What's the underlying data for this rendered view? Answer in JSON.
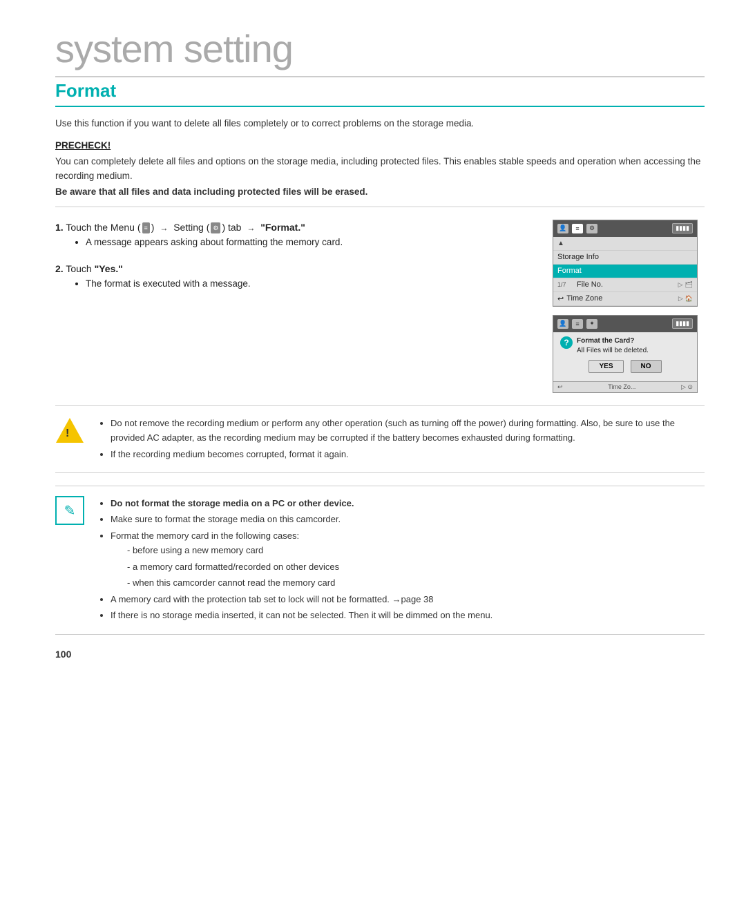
{
  "page": {
    "title": "system setting",
    "section": "Format",
    "page_number": "100"
  },
  "intro": {
    "text": "Use this function if you want to delete all files completely or to correct problems on the storage media."
  },
  "precheck": {
    "label": "PRECHECK!",
    "text1": "You can completely delete all files and options on the storage media, including protected files. This enables stable speeds and operation when accessing the recording medium.",
    "text2": "Be aware that all files and data including protected files will be erased."
  },
  "steps": [
    {
      "number": "1.",
      "text": "Touch the Menu (",
      "middle": ") → Setting (",
      "end": ") tab → \"Format.\"",
      "bullets": [
        "A message appears asking about formatting the memory card."
      ]
    },
    {
      "number": "2.",
      "text": "Touch \"Yes.\"",
      "bullets": [
        "The format is executed with a message."
      ]
    }
  ],
  "camera_screen1": {
    "menu_items": [
      "Storage Info",
      "Format",
      "File No.",
      "Time Zone"
    ],
    "selected": "Format",
    "row_num": "1/7"
  },
  "camera_screen2": {
    "dialog_question": "Format the Card?",
    "dialog_sub": "All Files will be deleted.",
    "yes_btn": "YES",
    "no_btn": "NO",
    "bottom_label": "Time Zo...",
    "bottom_icon": "▷ ⊙"
  },
  "warning": {
    "bullets": [
      "Do not remove the recording medium or perform any other operation (such as turning off the power) during formatting. Also, be sure to use the provided AC adapter, as the recording medium may be corrupted if the battery becomes exhausted during formatting.",
      "If the recording medium becomes corrupted, format it again."
    ]
  },
  "note": {
    "items": [
      {
        "bold": true,
        "text": "Do not format the storage media on a PC or other device."
      },
      {
        "bold": false,
        "text": "Make sure to format the storage media on this camcorder."
      },
      {
        "bold": false,
        "text": "Format the memory card in the following cases:",
        "sub_items": [
          "before using a new memory card",
          "a memory card formatted/recorded on other devices",
          "when this camcorder cannot read the memory card"
        ]
      },
      {
        "bold": false,
        "text": "A memory card with the protection tab set to lock will not be formatted. →page 38"
      },
      {
        "bold": false,
        "text": "If there is no storage media inserted, it can not be selected. Then it will be dimmed on the menu."
      }
    ]
  }
}
